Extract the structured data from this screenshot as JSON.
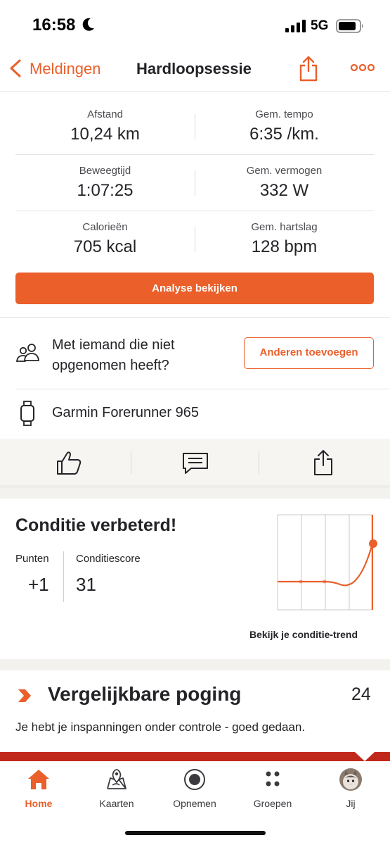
{
  "status_bar": {
    "time": "16:58",
    "network": "5G",
    "icons": [
      "moon-icon",
      "signal-icon",
      "battery-icon"
    ]
  },
  "navbar": {
    "back_label": "Meldingen",
    "title": "Hardloopsessie",
    "icons": [
      "chevron-left-icon",
      "share-icon",
      "more-icon"
    ]
  },
  "stats": [
    {
      "left": {
        "label": "Afstand",
        "value": "10,24 km"
      },
      "right": {
        "label": "Gem. tempo",
        "value": "6:35 /km."
      }
    },
    {
      "left": {
        "label": "Beweegtijd",
        "value": "1:07:25"
      },
      "right": {
        "label": "Gem. vermogen",
        "value": "332 W"
      }
    },
    {
      "left": {
        "label": "Calorieën",
        "value": "705 kcal"
      },
      "right": {
        "label": "Gem. hartslag",
        "value": "128 bpm"
      }
    }
  ],
  "analysis_button": "Analyse bekijken",
  "tag": {
    "text": "Met iemand die niet opgenomen heeft?",
    "button": "Anderen toevoegen"
  },
  "device": {
    "name": "Garmin Forerunner 965"
  },
  "social": {
    "icons": [
      "kudos-icon",
      "comment-icon",
      "share-icon"
    ]
  },
  "fitness": {
    "title": "Conditie verbeterd!",
    "points_label": "Punten",
    "points_value": "+1",
    "score_label": "Conditiescore",
    "score_value": "31",
    "trend_link": "Bekijk je conditie-trend"
  },
  "similar": {
    "title": "Vergelijkbare poging",
    "count": "24",
    "description": "Je hebt je inspanningen onder controle - goed gedaan."
  },
  "tabs": [
    {
      "label": "Home",
      "icon": "home-icon",
      "active": true
    },
    {
      "label": "Kaarten",
      "icon": "map-icon",
      "active": false
    },
    {
      "label": "Opnemen",
      "icon": "record-icon",
      "active": false
    },
    {
      "label": "Groepen",
      "icon": "groups-icon",
      "active": false
    },
    {
      "label": "Jij",
      "icon": "avatar",
      "active": false
    }
  ],
  "colors": {
    "accent": "#ea5f2a",
    "text": "#242428",
    "tab_strip": "#c1281c",
    "band": "#f3f2ef"
  }
}
